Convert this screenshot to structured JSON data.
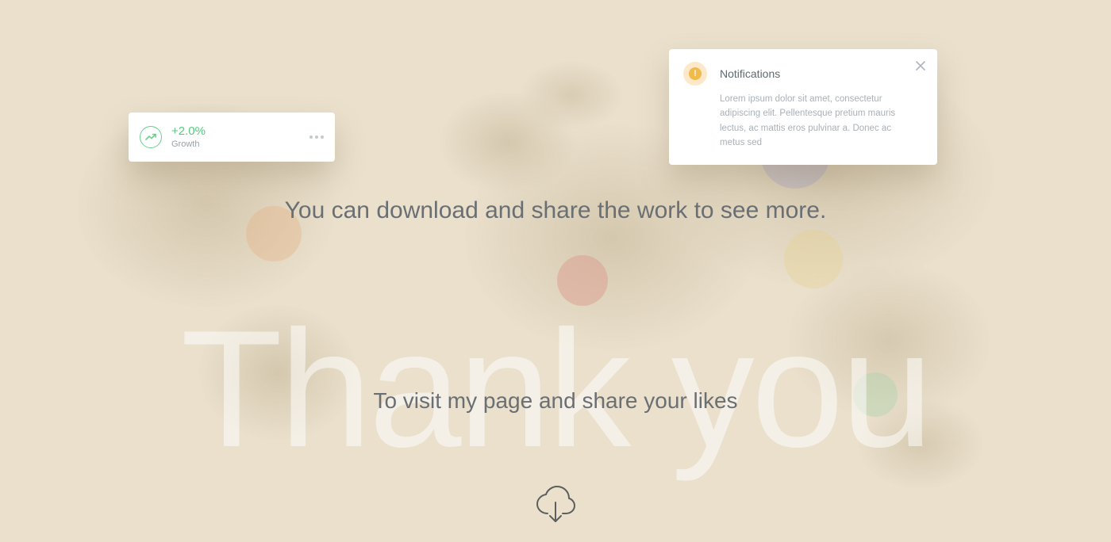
{
  "stat": {
    "value": "+2.0%",
    "label": "Growth",
    "icon": "trend-up"
  },
  "notification": {
    "title": "Notifications",
    "body": "Lorem ipsum dolor sit amet, consectetur adipiscing elit. Pellentesque pretium mauris lectus, ac mattis eros pulvinar a. Donec ac metus sed",
    "icon": "alert"
  },
  "headline": "You can download and share the work to see more.",
  "watermark": "Thank you",
  "subline": "To visit my page and share your likes",
  "colors": {
    "bg": "#eae0cc",
    "accent_green": "#58c97f",
    "notif_accent": "#f2b94b",
    "text_muted": "#6a6f73"
  }
}
